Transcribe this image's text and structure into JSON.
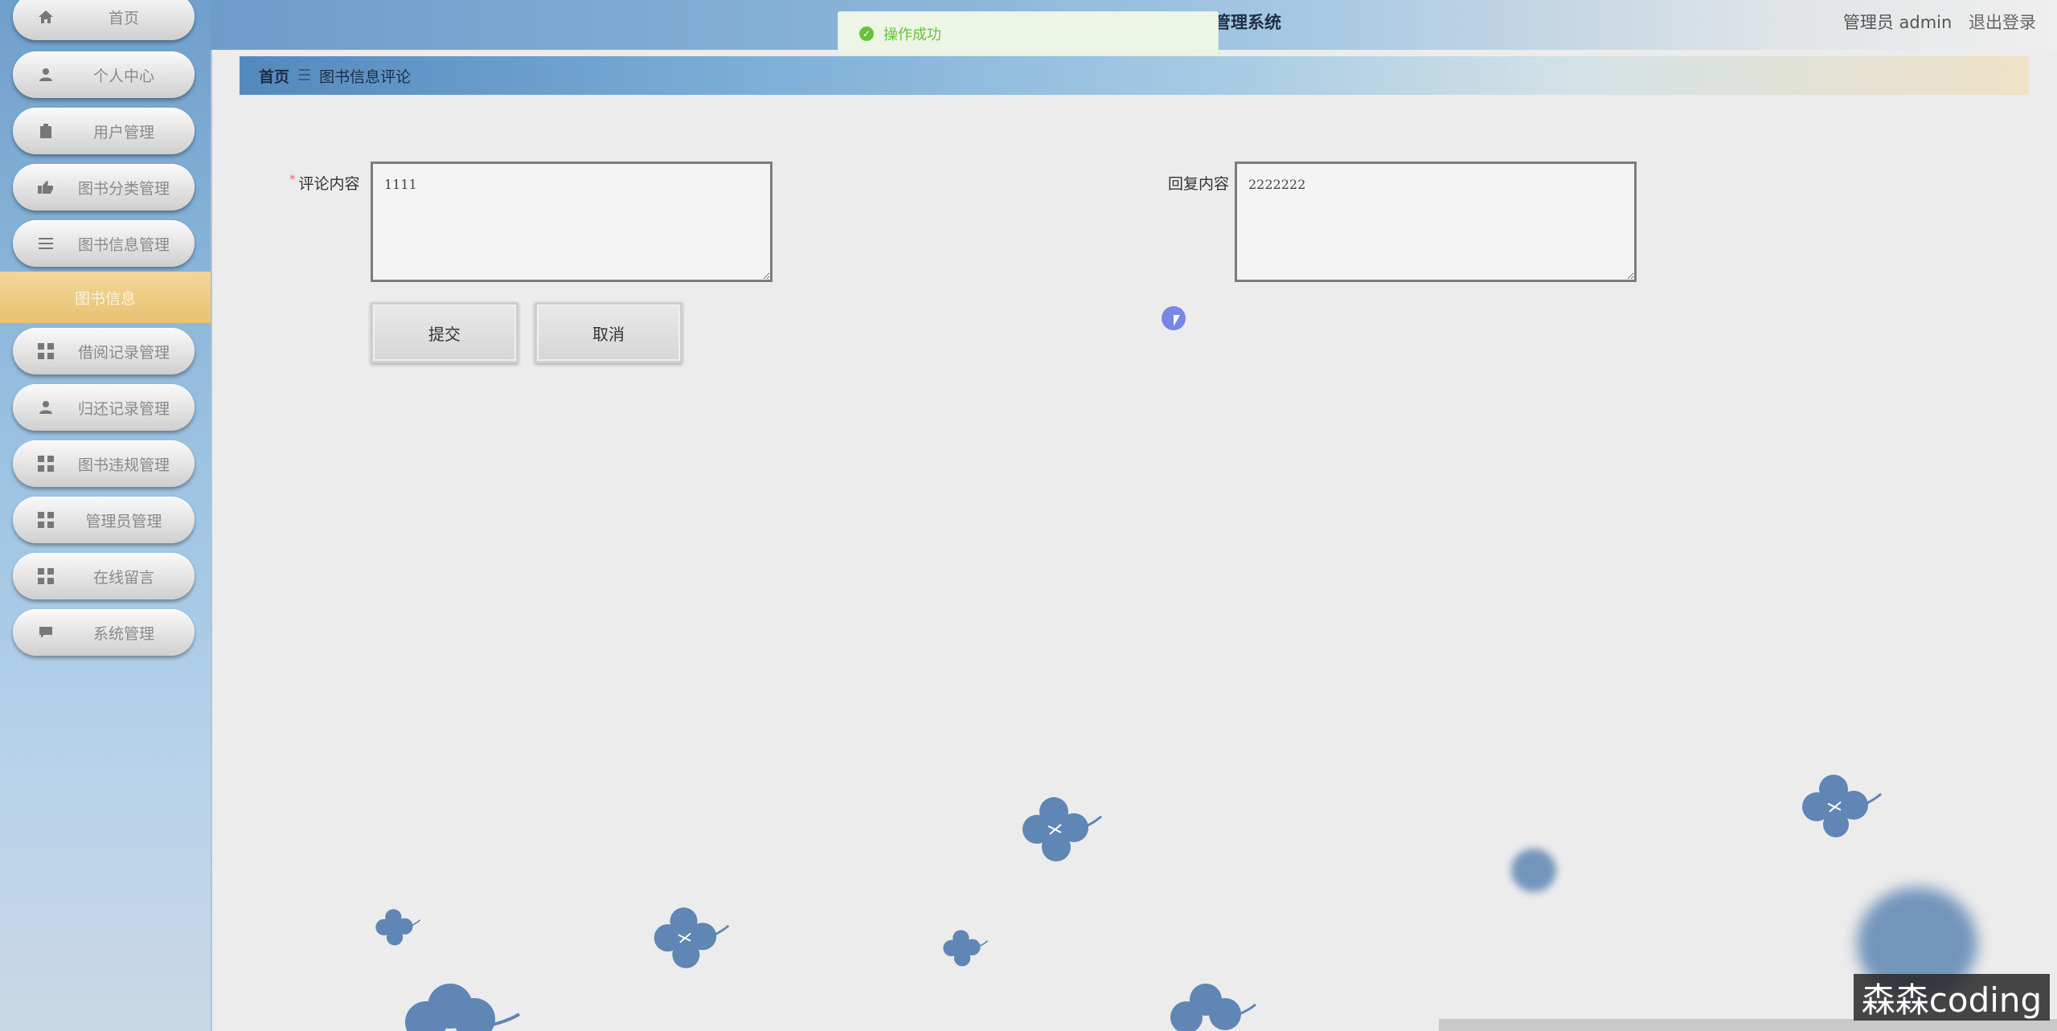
{
  "sidebar": {
    "items": [
      {
        "label": "首页",
        "icon": "home-icon"
      },
      {
        "label": "个人中心",
        "icon": "person-icon"
      },
      {
        "label": "用户管理",
        "icon": "clipboard-icon"
      },
      {
        "label": "图书分类管理",
        "icon": "thumb-icon"
      },
      {
        "label": "图书信息管理",
        "icon": "list-icon"
      },
      {
        "label": "借阅记录管理",
        "icon": "grid-icon"
      },
      {
        "label": "归还记录管理",
        "icon": "person-icon"
      },
      {
        "label": "图书违规管理",
        "icon": "grid-icon"
      },
      {
        "label": "管理员管理",
        "icon": "grid-icon"
      },
      {
        "label": "在线留言",
        "icon": "grid-icon"
      },
      {
        "label": "系统管理",
        "icon": "chat-icon"
      }
    ],
    "active_sub": "图书信息"
  },
  "header": {
    "title": "管理系统",
    "role": "管理员 admin",
    "logout": "退出登录"
  },
  "toast": {
    "message": "操作成功",
    "color": "#67c23a"
  },
  "breadcrumb": {
    "home": "首页",
    "separator": "☰",
    "current": "图书信息评论"
  },
  "form": {
    "comment_label": "评论内容",
    "comment_required": "*",
    "comment_value": "1111",
    "reply_label": "回复内容",
    "reply_value": "2222222",
    "submit_label": "提交",
    "cancel_label": "取消"
  },
  "watermark": "森森coding",
  "colors": {
    "sidebar_top": "#6f9fcb",
    "active_sub": "#e9c170",
    "flower": "#5f86b4"
  }
}
